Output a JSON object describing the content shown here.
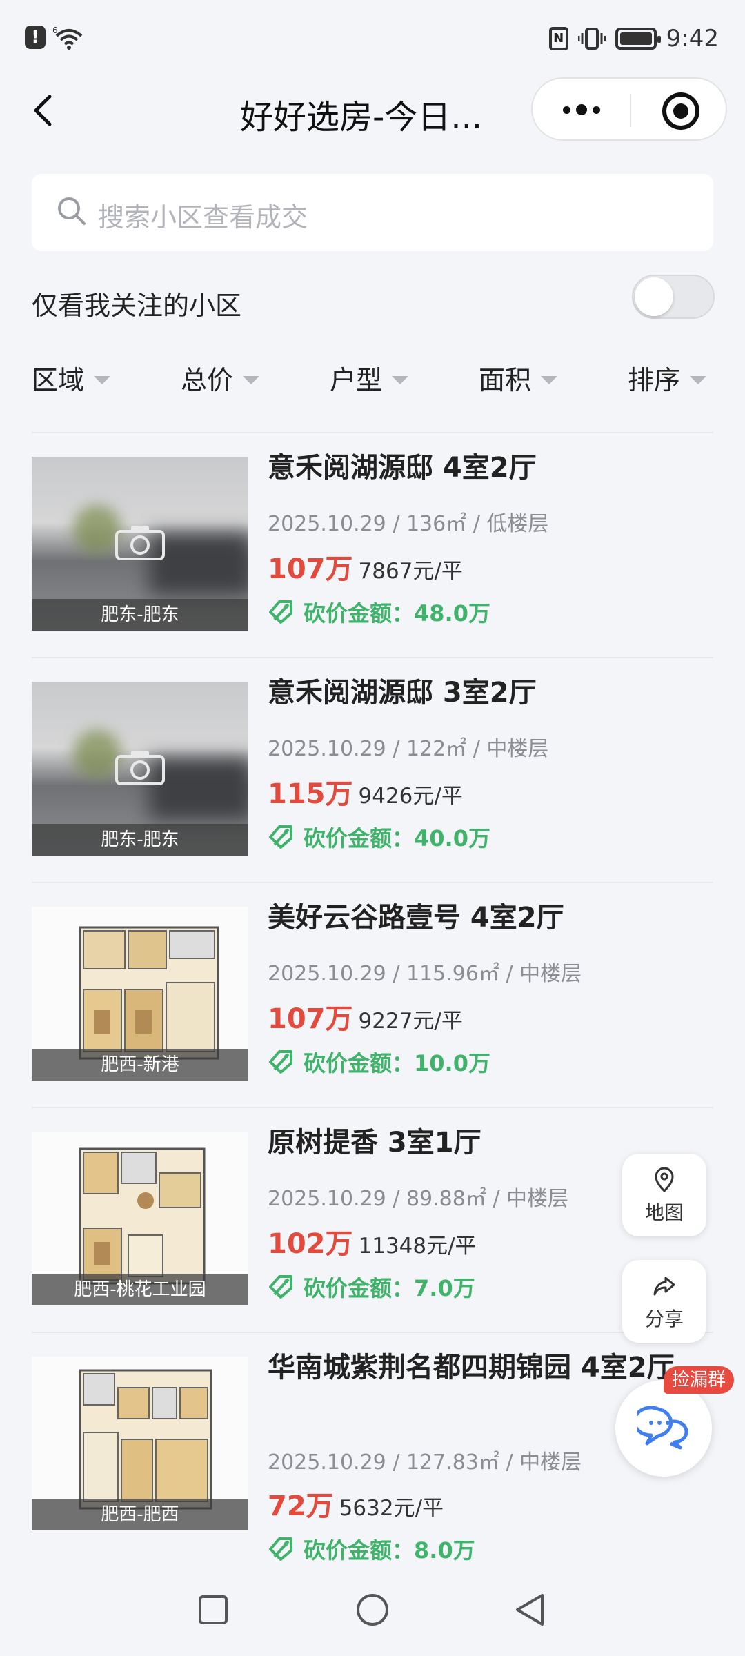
{
  "status_bar": {
    "time": "9:42",
    "signal_label": "6"
  },
  "nav": {
    "title": "好好选房-今日...",
    "more_label": "more",
    "close_label": "close"
  },
  "search": {
    "placeholder": "搜索小区查看成交"
  },
  "follow": {
    "label": "仅看我关注的小区",
    "enabled": false
  },
  "filters": [
    "区域",
    "总价",
    "户型",
    "面积",
    "排序"
  ],
  "listings": [
    {
      "title": "意禾阅湖源邸 4室2厅",
      "date": "2025.10.29",
      "area": "136㎡",
      "floor": "低楼层",
      "price": "107万",
      "unit_price": "7867元/平",
      "cut_label": "砍价金额：",
      "cut_value": "48.0万",
      "district": "肥东-肥东",
      "image": "blurred-placeholder"
    },
    {
      "title": "意禾阅湖源邸 3室2厅",
      "date": "2025.10.29",
      "area": "122㎡",
      "floor": "中楼层",
      "price": "115万",
      "unit_price": "9426元/平",
      "cut_label": "砍价金额：",
      "cut_value": "40.0万",
      "district": "肥东-肥东",
      "image": "blurred-placeholder"
    },
    {
      "title": "美好云谷路壹号 4室2厅",
      "date": "2025.10.29",
      "area": "115.96㎡",
      "floor": "中楼层",
      "price": "107万",
      "unit_price": "9227元/平",
      "cut_label": "砍价金额：",
      "cut_value": "10.0万",
      "district": "肥西-新港",
      "image": "floor-plan"
    },
    {
      "title": "原树提香 3室1厅",
      "date": "2025.10.29",
      "area": "89.88㎡",
      "floor": "中楼层",
      "price": "102万",
      "unit_price": "11348元/平",
      "cut_label": "砍价金额：",
      "cut_value": "7.0万",
      "district": "肥西-桃花工业园",
      "image": "floor-plan"
    },
    {
      "title": "华南城紫荆名都四期锦园 4室2厅",
      "date": "2025.10.29",
      "area": "127.83㎡",
      "floor": "中楼层",
      "price": "72万",
      "unit_price": "5632元/平",
      "cut_label": "砍价金额：",
      "cut_value": "8.0万",
      "district": "肥西-肥西",
      "image": "floor-plan"
    }
  ],
  "floating": {
    "map_label": "地图",
    "share_label": "分享",
    "chat_badge": "捡漏群"
  },
  "colors": {
    "price": "#e24a3d",
    "cut": "#3fb36a",
    "background": "#f4f5f9",
    "badge": "#e94a3f"
  },
  "icons": {
    "map": "map-pin-icon",
    "share": "share-icon",
    "chat": "chat-bubbles-icon",
    "tag": "price-tag-icon"
  }
}
